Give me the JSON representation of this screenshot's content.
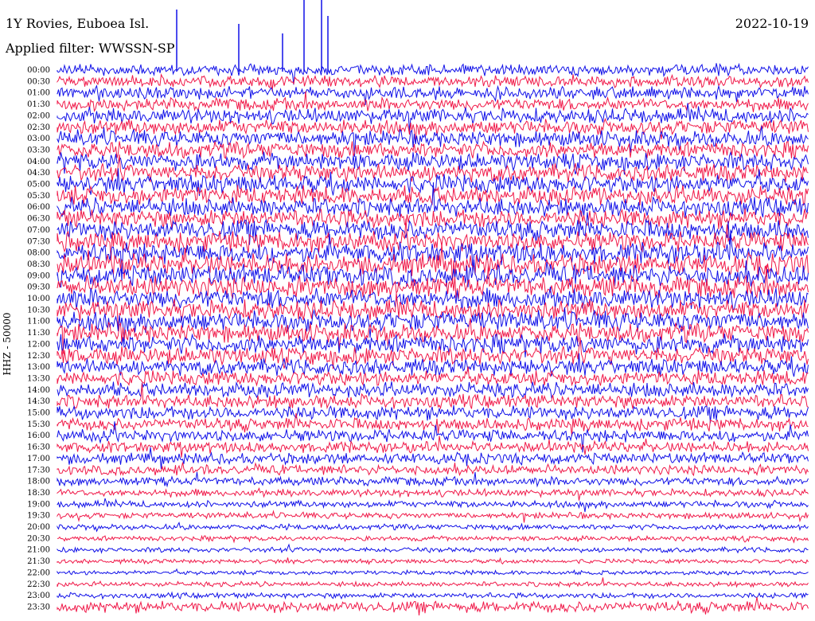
{
  "header": {
    "station": "1Y Rovies, Euboea Isl.",
    "date": "2022-10-19",
    "filter": "Applied filter: WWSSN-SP"
  },
  "chart_data": {
    "type": "line",
    "title": "1Y Rovies, Euboea Isl.",
    "ylabel": "HHZ - 50000",
    "xlabel": "",
    "grid": false,
    "row_labels": [
      "00:00",
      "00:30",
      "01:00",
      "01:30",
      "02:00",
      "02:30",
      "03:00",
      "03:30",
      "04:00",
      "04:30",
      "05:00",
      "05:30",
      "06:00",
      "06:30",
      "07:00",
      "07:30",
      "08:00",
      "08:30",
      "09:00",
      "09:30",
      "10:00",
      "10:30",
      "11:00",
      "11:30",
      "12:00",
      "12:30",
      "13:00",
      "13:30",
      "14:00",
      "14:30",
      "15:00",
      "15:30",
      "16:00",
      "16:30",
      "17:00",
      "17:30",
      "18:00",
      "18:30",
      "19:00",
      "19:30",
      "20:00",
      "20:30",
      "21:00",
      "21:30",
      "22:00",
      "22:30",
      "23:00",
      "23:30"
    ],
    "row_amplitude": [
      0.9,
      0.9,
      1.0,
      1.0,
      1.2,
      1.2,
      1.3,
      1.3,
      1.4,
      1.4,
      1.5,
      1.5,
      1.5,
      1.5,
      1.6,
      1.6,
      1.7,
      1.7,
      1.7,
      1.7,
      1.6,
      1.6,
      1.6,
      1.5,
      1.5,
      1.4,
      1.3,
      1.2,
      1.2,
      1.1,
      1.1,
      1.0,
      1.0,
      0.9,
      0.9,
      0.8,
      0.7,
      0.6,
      0.55,
      0.5,
      0.45,
      0.4,
      0.4,
      0.35,
      0.35,
      0.4,
      0.45,
      0.9
    ],
    "series_colors": [
      "#1010e8",
      "#f01848"
    ]
  }
}
